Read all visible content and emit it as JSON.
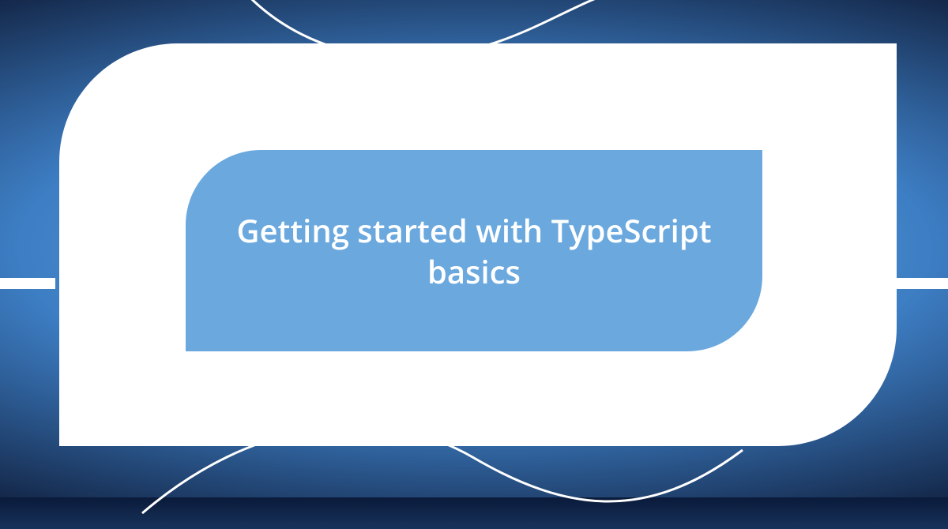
{
  "card": {
    "title": "Getting started with TypeScript basics"
  },
  "colors": {
    "inner_bg": "#6aa8de",
    "outer_bg": "#ffffff",
    "text": "#ffffff"
  }
}
